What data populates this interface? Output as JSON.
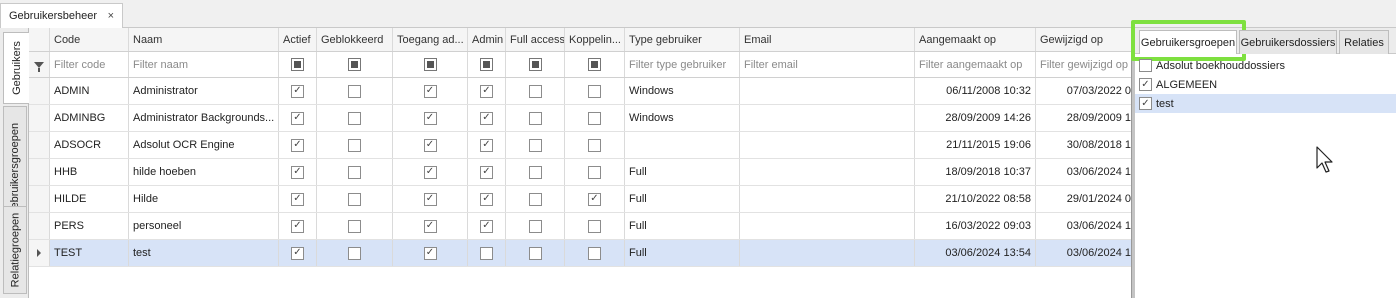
{
  "document_tab": {
    "label": "Gebruikersbeheer",
    "close_glyph": "×"
  },
  "side_tabs": [
    "Gebruikers",
    "Gebruikersgroepen",
    "Relatiegroepen"
  ],
  "grid": {
    "columns": [
      "Code",
      "Naam",
      "Actief",
      "Geblokkeerd",
      "Toegang ad...",
      "Admin",
      "Full access",
      "Koppelin...",
      "Type gebruiker",
      "Email",
      "Aangemaakt op",
      "Gewijzigd op"
    ],
    "filters": {
      "code": "Filter code",
      "naam": "Filter naam",
      "type": "Filter type gebruiker",
      "email": "Filter email",
      "aangemaakt": "Filter aangemaakt op",
      "gewijzigd": "Filter gewijzigd op"
    },
    "rows": [
      {
        "code": "ADMIN",
        "naam": "Administrator",
        "actief": true,
        "geblokkeerd": false,
        "toegang": true,
        "admin": true,
        "full_access": false,
        "koppeling": false,
        "type": "Windows",
        "email": "",
        "aangemaakt": "06/11/2008 10:32",
        "gewijzigd": "07/03/2022 0"
      },
      {
        "code": "ADMINBG",
        "naam": "Administrator Backgrounds...",
        "actief": true,
        "geblokkeerd": false,
        "toegang": true,
        "admin": true,
        "full_access": false,
        "koppeling": false,
        "type": "Windows",
        "email": "",
        "aangemaakt": "28/09/2009 14:26",
        "gewijzigd": "28/09/2009 1"
      },
      {
        "code": "ADSOCR",
        "naam": "Adsolut OCR Engine",
        "actief": true,
        "geblokkeerd": false,
        "toegang": true,
        "admin": true,
        "full_access": false,
        "koppeling": false,
        "type": "",
        "email": "",
        "aangemaakt": "21/11/2015 19:06",
        "gewijzigd": "30/08/2018 1"
      },
      {
        "code": "HHB",
        "naam": "hilde hoeben",
        "actief": true,
        "geblokkeerd": false,
        "toegang": true,
        "admin": true,
        "full_access": false,
        "koppeling": false,
        "type": "Full",
        "email": "",
        "aangemaakt": "18/09/2018 10:37",
        "gewijzigd": "03/06/2024 1"
      },
      {
        "code": "HILDE",
        "naam": "Hilde",
        "actief": true,
        "geblokkeerd": false,
        "toegang": true,
        "admin": true,
        "full_access": false,
        "koppeling": true,
        "type": "Full",
        "email": "",
        "aangemaakt": "21/10/2022 08:58",
        "gewijzigd": "29/01/2024 0"
      },
      {
        "code": "PERS",
        "naam": "personeel",
        "actief": true,
        "geblokkeerd": false,
        "toegang": true,
        "admin": true,
        "full_access": false,
        "koppeling": false,
        "type": "Full",
        "email": "",
        "aangemaakt": "16/03/2022 09:03",
        "gewijzigd": "03/06/2024 1"
      },
      {
        "code": "TEST",
        "naam": "test",
        "actief": true,
        "geblokkeerd": false,
        "toegang": true,
        "admin": false,
        "full_access": false,
        "koppeling": false,
        "type": "Full",
        "email": "",
        "aangemaakt": "03/06/2024 13:54",
        "gewijzigd": "03/06/2024 1"
      }
    ],
    "selected_row_index": 6
  },
  "right_panel": {
    "tabs": [
      "Gebruikersgroepen",
      "Gebruikersdossiers",
      "Relaties"
    ],
    "active_tab_index": 0,
    "groups": [
      {
        "label": "Adsolut boekhouddossiers",
        "checked": false
      },
      {
        "label": "ALGEMEEN",
        "checked": true
      },
      {
        "label": "test",
        "checked": true
      }
    ],
    "selected_group_index": 2
  },
  "colors": {
    "highlight": "#7ee03f",
    "selection": "#d7e3f7"
  },
  "icons": {
    "filter": "filter-icon",
    "row_indicator": "row-pointer-icon",
    "cursor": "mouse-cursor-icon"
  }
}
